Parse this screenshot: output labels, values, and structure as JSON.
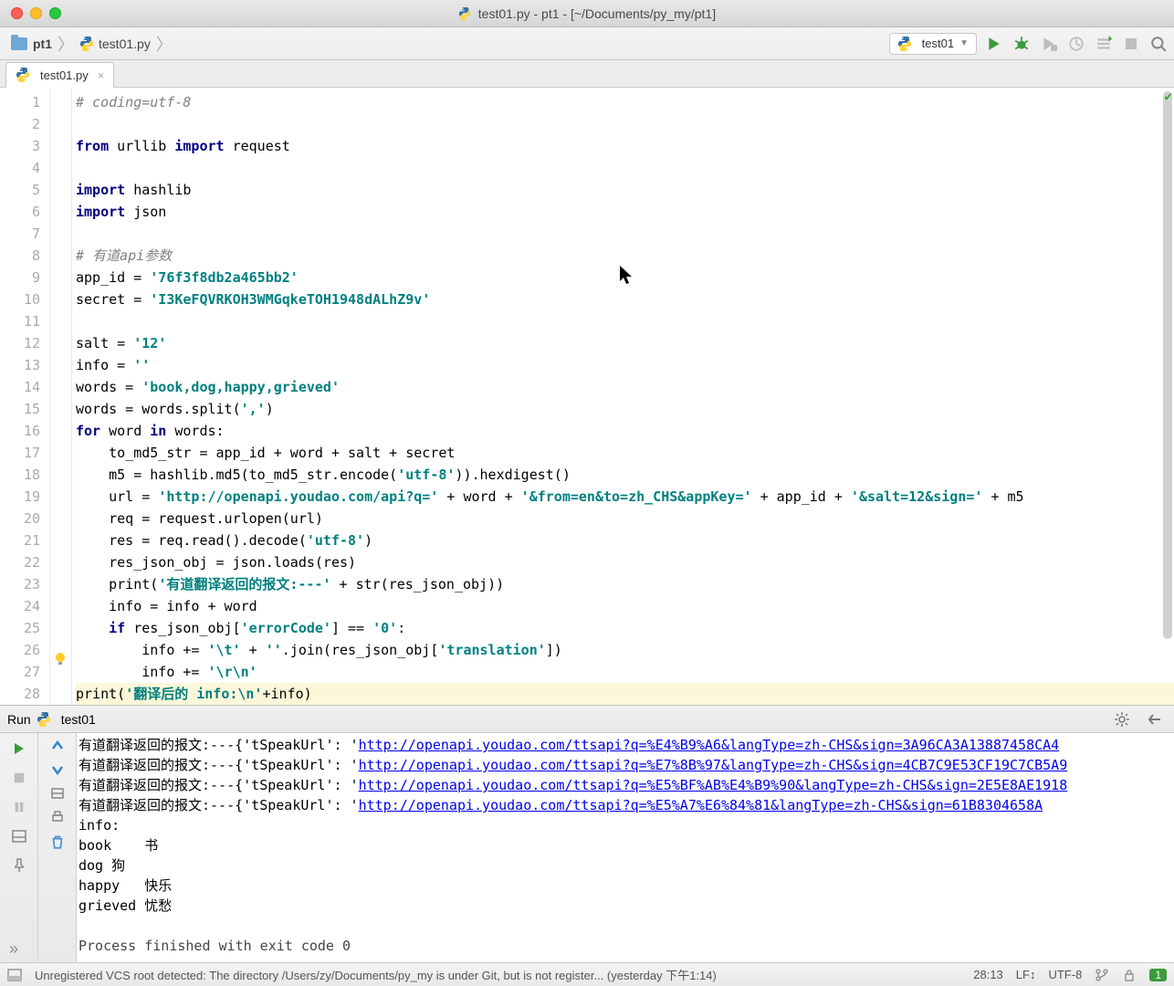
{
  "window": {
    "title": "test01.py - pt1 - [~/Documents/py_my/pt1]"
  },
  "breadcrumb": {
    "root": "pt1",
    "file": "test01.py"
  },
  "run_config": {
    "name": "test01"
  },
  "tab": {
    "name": "test01.py"
  },
  "code_lines": [
    "# coding=utf-8",
    "",
    "from urllib import request",
    "",
    "import hashlib",
    "import json",
    "",
    "# 有道api参数",
    "app_id = '76f3f8db2a465bb2'",
    "secret = 'I3KeFQVRKOH3WMGqkeTOH1948dALhZ9v'",
    "",
    "salt = '12'",
    "info = ''",
    "words = 'book,dog,happy,grieved'",
    "words = words.split(',')",
    "for word in words:",
    "    to_md5_str = app_id + word + salt + secret",
    "    m5 = hashlib.md5(to_md5_str.encode('utf-8')).hexdigest()",
    "    url = 'http://openapi.youdao.com/api?q=' + word + '&from=en&to=zh_CHS&appKey=' + app_id + '&salt=12&sign=' + m5",
    "    req = request.urlopen(url)",
    "    res = req.read().decode('utf-8')",
    "    res_json_obj = json.loads(res)",
    "    print('有道翻译返回的报文:---' + str(res_json_obj))",
    "    info = info + word",
    "    if res_json_obj['errorCode'] == '0':",
    "        info += '\\t' + ''.join(res_json_obj['translation'])",
    "        info += '\\r\\n'",
    "print('翻译后的 info:\\n'+info)",
    ""
  ],
  "console": {
    "title_prefix": "Run",
    "title_config": "test01",
    "lines": [
      {
        "prefix": "有道翻译返回的报文:---{'tSpeakUrl': '",
        "url": "http://openapi.youdao.com/ttsapi?q=%E4%B9%A6&langType=zh-CHS&sign=3A96CA3A13887458CA4"
      },
      {
        "prefix": "有道翻译返回的报文:---{'tSpeakUrl': '",
        "url": "http://openapi.youdao.com/ttsapi?q=%E7%8B%97&langType=zh-CHS&sign=4CB7C9E53CF19C7CB5A9"
      },
      {
        "prefix": "有道翻译返回的报文:---{'tSpeakUrl': '",
        "url": "http://openapi.youdao.com/ttsapi?q=%E5%BF%AB%E4%B9%90&langType=zh-CHS&sign=2E5E8AE1918"
      },
      {
        "prefix": "有道翻译返回的报文:---{'tSpeakUrl': '",
        "url": "http://openapi.youdao.com/ttsapi?q=%E5%A7%E6%84%81&langType=zh-CHS&sign=61B8304658A"
      }
    ],
    "info_label": "info:",
    "results": [
      "book    书",
      "dog 狗",
      "happy   快乐",
      "grieved 忧愁"
    ],
    "exit": "Process finished with exit code 0"
  },
  "status": {
    "vcs_msg": "Unregistered VCS root detected: The directory /Users/zy/Documents/py_my is under Git, but is not register... (yesterday 下午1:14)",
    "caret": "28:13",
    "line_sep": "LF",
    "encoding": "UTF-8",
    "badge": "1"
  }
}
